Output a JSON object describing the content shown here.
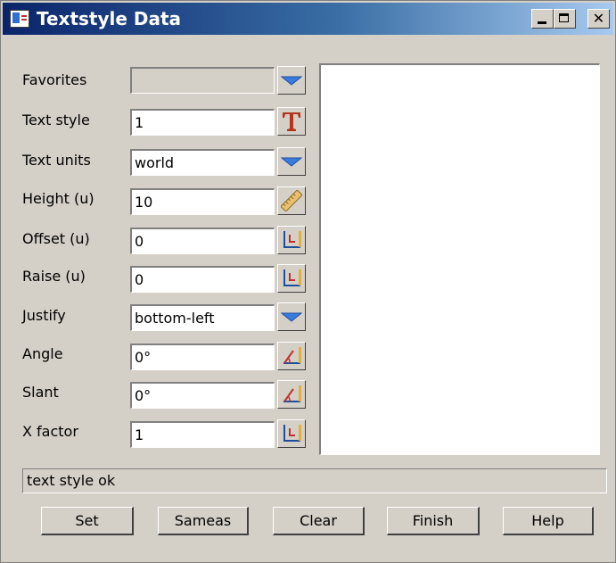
{
  "window": {
    "title": "Textstyle Data",
    "close_glyph": "✕"
  },
  "form": {
    "favorites": {
      "label": "Favorites",
      "value": ""
    },
    "text_style": {
      "label": "Text style",
      "value": "1"
    },
    "text_units": {
      "label": "Text units",
      "value": "world"
    },
    "height": {
      "label": "Height (u)",
      "value": "10"
    },
    "offset": {
      "label": "Offset (u)",
      "value": "0"
    },
    "raise": {
      "label": "Raise (u)",
      "value": "0"
    },
    "justify": {
      "label": "Justify",
      "value": "bottom-left"
    },
    "angle": {
      "label": "Angle",
      "value": "0°"
    },
    "slant": {
      "label": "Slant",
      "value": "0°"
    },
    "x_factor": {
      "label": "X factor",
      "value": "1"
    }
  },
  "status": {
    "text": "text style ok"
  },
  "buttons": {
    "set": "Set",
    "sameas": "Sameas",
    "clear": "Clear",
    "finish": "Finish",
    "help": "Help"
  },
  "icons": {
    "dropdown": "dropdown-triangle-icon",
    "text_style_picker": "text-style-T-icon",
    "ruler": "ruler-icon",
    "measure": "axis-measure-icon",
    "angle": "angle-measure-icon"
  },
  "colors": {
    "title_gradient_start": "#0a246a",
    "title_gradient_end": "#a6caf0",
    "dialog_bg": "#d4d0c8",
    "dropdown_blue": "#3a7be0",
    "text_style_T": "#b5341c"
  }
}
